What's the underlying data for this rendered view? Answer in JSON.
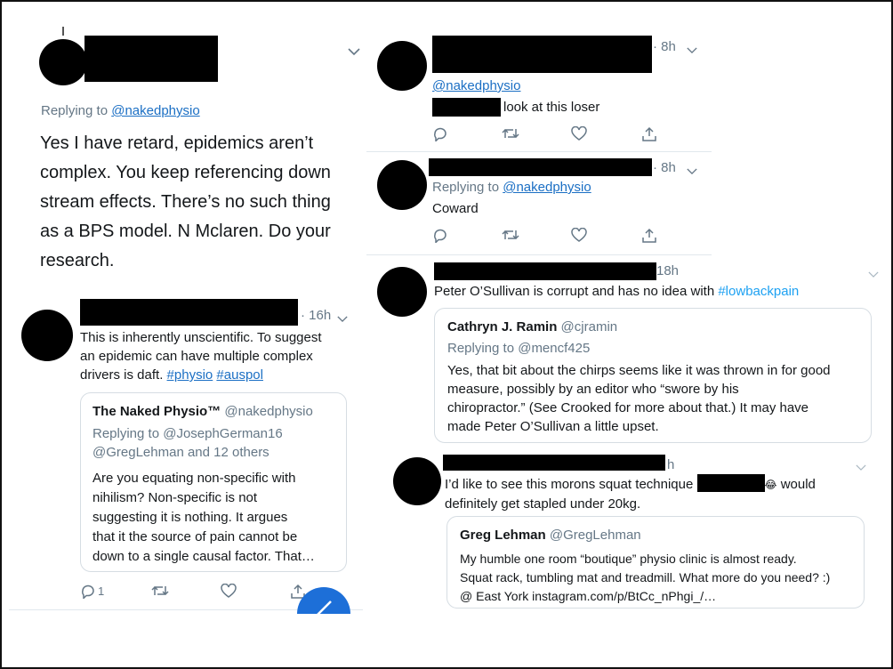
{
  "left": {
    "top_tweet": {
      "replying_prefix": "Replying to",
      "replying_handle": "@nakedphysio",
      "body_lines": [
        "Yes I have retard, epidemics aren’t",
        "complex. You keep referencing down",
        "stream effects. There’s no such thing",
        "as a BPS model. N Mclaren. Do your",
        "research."
      ]
    },
    "reply": {
      "time": "· 16h",
      "body_lines": [
        "This is inherently unscientific. To suggest",
        "an epidemic can have multiple complex"
      ],
      "body_last_prefix": "drivers is daft.",
      "hashtags": [
        "#physio",
        "#auspol"
      ],
      "quote": {
        "name": "The Naked Physio™",
        "handle": "@nakedphysio",
        "replying_line1": "Replying to @JosephGerman16",
        "replying_line2": "@GregLehman and 12 others",
        "body_lines": [
          "Are you equating non-specific with",
          "nihilism? Non-specific is not",
          "suggesting it is nothing. It argues",
          "that it the source of pain cannot be",
          "down to a single causal factor. That…"
        ]
      },
      "reply_count": "1"
    }
  },
  "right": {
    "tweet1": {
      "time": "· 8h",
      "handle_link": "@nakedphysio",
      "body": "look at this loser"
    },
    "tweet2": {
      "time": "· 8h",
      "replying_prefix": "Replying to",
      "replying_handle": "@nakedphysio",
      "body": "Coward"
    },
    "tweet3": {
      "time": "18h",
      "body": "Peter O’Sullivan is corrupt and has no idea with",
      "hashtag": "#lowbackpain",
      "quote": {
        "name": "Cathryn J. Ramin",
        "handle": "@cjramin",
        "replying": "Replying to @mencf425",
        "body_lines": [
          "Yes, that bit about the chirps seems like it was thrown in for good",
          "measure, possibly by an editor who “swore by his",
          "chiropractor.”  (See Crooked for more about that.) It may have",
          "made Peter O’Sullivan a little upset."
        ]
      }
    },
    "tweet4": {
      "time": "h",
      "body_prefix": "I’d like to see this morons squat technique",
      "emoji": "😂",
      "body_suffix": "would",
      "body_line2": "definitely get stapled under 20kg.",
      "quote": {
        "name": "Greg Lehman",
        "handle": "@GregLehman",
        "body_lines": [
          "My humble one room “boutique” physio clinic is almost ready.",
          "Squat rack, tumbling mat and treadmill. What more do you need? :)",
          "@ East York instagram.com/p/BtCc_nPhgi_/…"
        ]
      }
    }
  },
  "icons": [
    "reply-icon",
    "retweet-icon",
    "like-icon",
    "share-icon",
    "chevron-down-icon"
  ],
  "colors": {
    "link": "#1b6fc4",
    "hashtag": "#1da1f2",
    "muted": "#657786",
    "fab": "#1da1f2"
  }
}
